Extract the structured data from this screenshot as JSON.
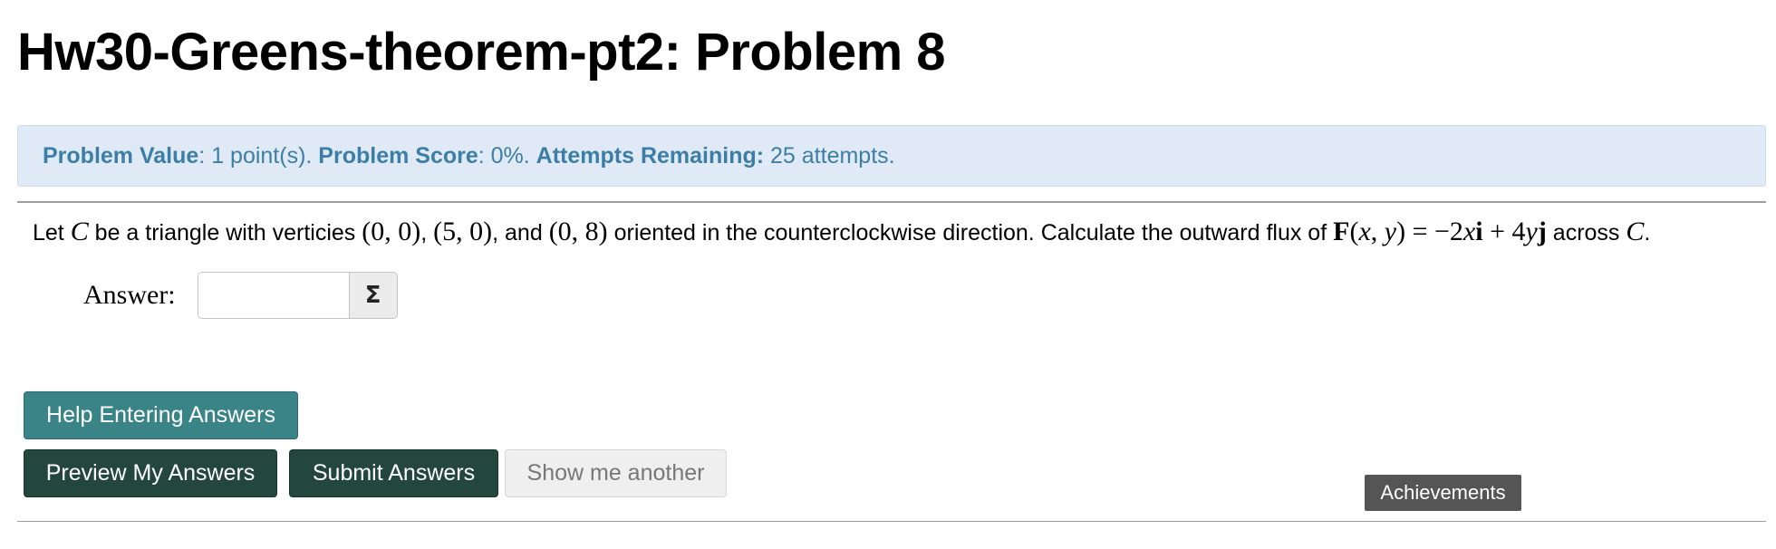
{
  "page": {
    "title": "Hw30-Greens-theorem-pt2: Problem 8"
  },
  "info": {
    "value_label": "Problem Value",
    "value_text": ": 1 point(s). ",
    "score_label": "Problem Score",
    "score_text": ": 0%. ",
    "attempts_label": "Attempts Remaining:",
    "attempts_text": " 25 attempts."
  },
  "problem": {
    "t1": "Let ",
    "m1": "C",
    "t2": " be a triangle with verticies ",
    "m2": "(0, 0)",
    "t3": ", ",
    "m3": "(5, 0)",
    "t4": ", and ",
    "m4": "(0, 8)",
    "t5": " oriented in the counterclockwise direction. Calculate the outward flux of ",
    "f_bold": "F",
    "f_open": "(",
    "f_x": "x",
    "f_comma": ", ",
    "f_y": "y",
    "f_close": ") = −2",
    "f_x2": "x",
    "f_i": "i",
    "f_plus": " + 4",
    "f_y2": "y",
    "f_j": "j",
    "t6": " across ",
    "m5": "C",
    "t7": "."
  },
  "answer": {
    "label": "Answer:",
    "value": "",
    "sigma_icon": "Σ"
  },
  "buttons": {
    "help": "Help Entering Answers",
    "preview": "Preview My Answers",
    "submit": "Submit Answers",
    "another": "Show me another"
  },
  "achievements": {
    "label": "Achievements"
  },
  "colors": {
    "info_background": "#dfeaf6",
    "info_text": "#3d7ea6",
    "help_button": "#3a8387",
    "primary_button": "#23463d",
    "disabled_button": "#efefef",
    "achievements_badge": "#555555"
  }
}
